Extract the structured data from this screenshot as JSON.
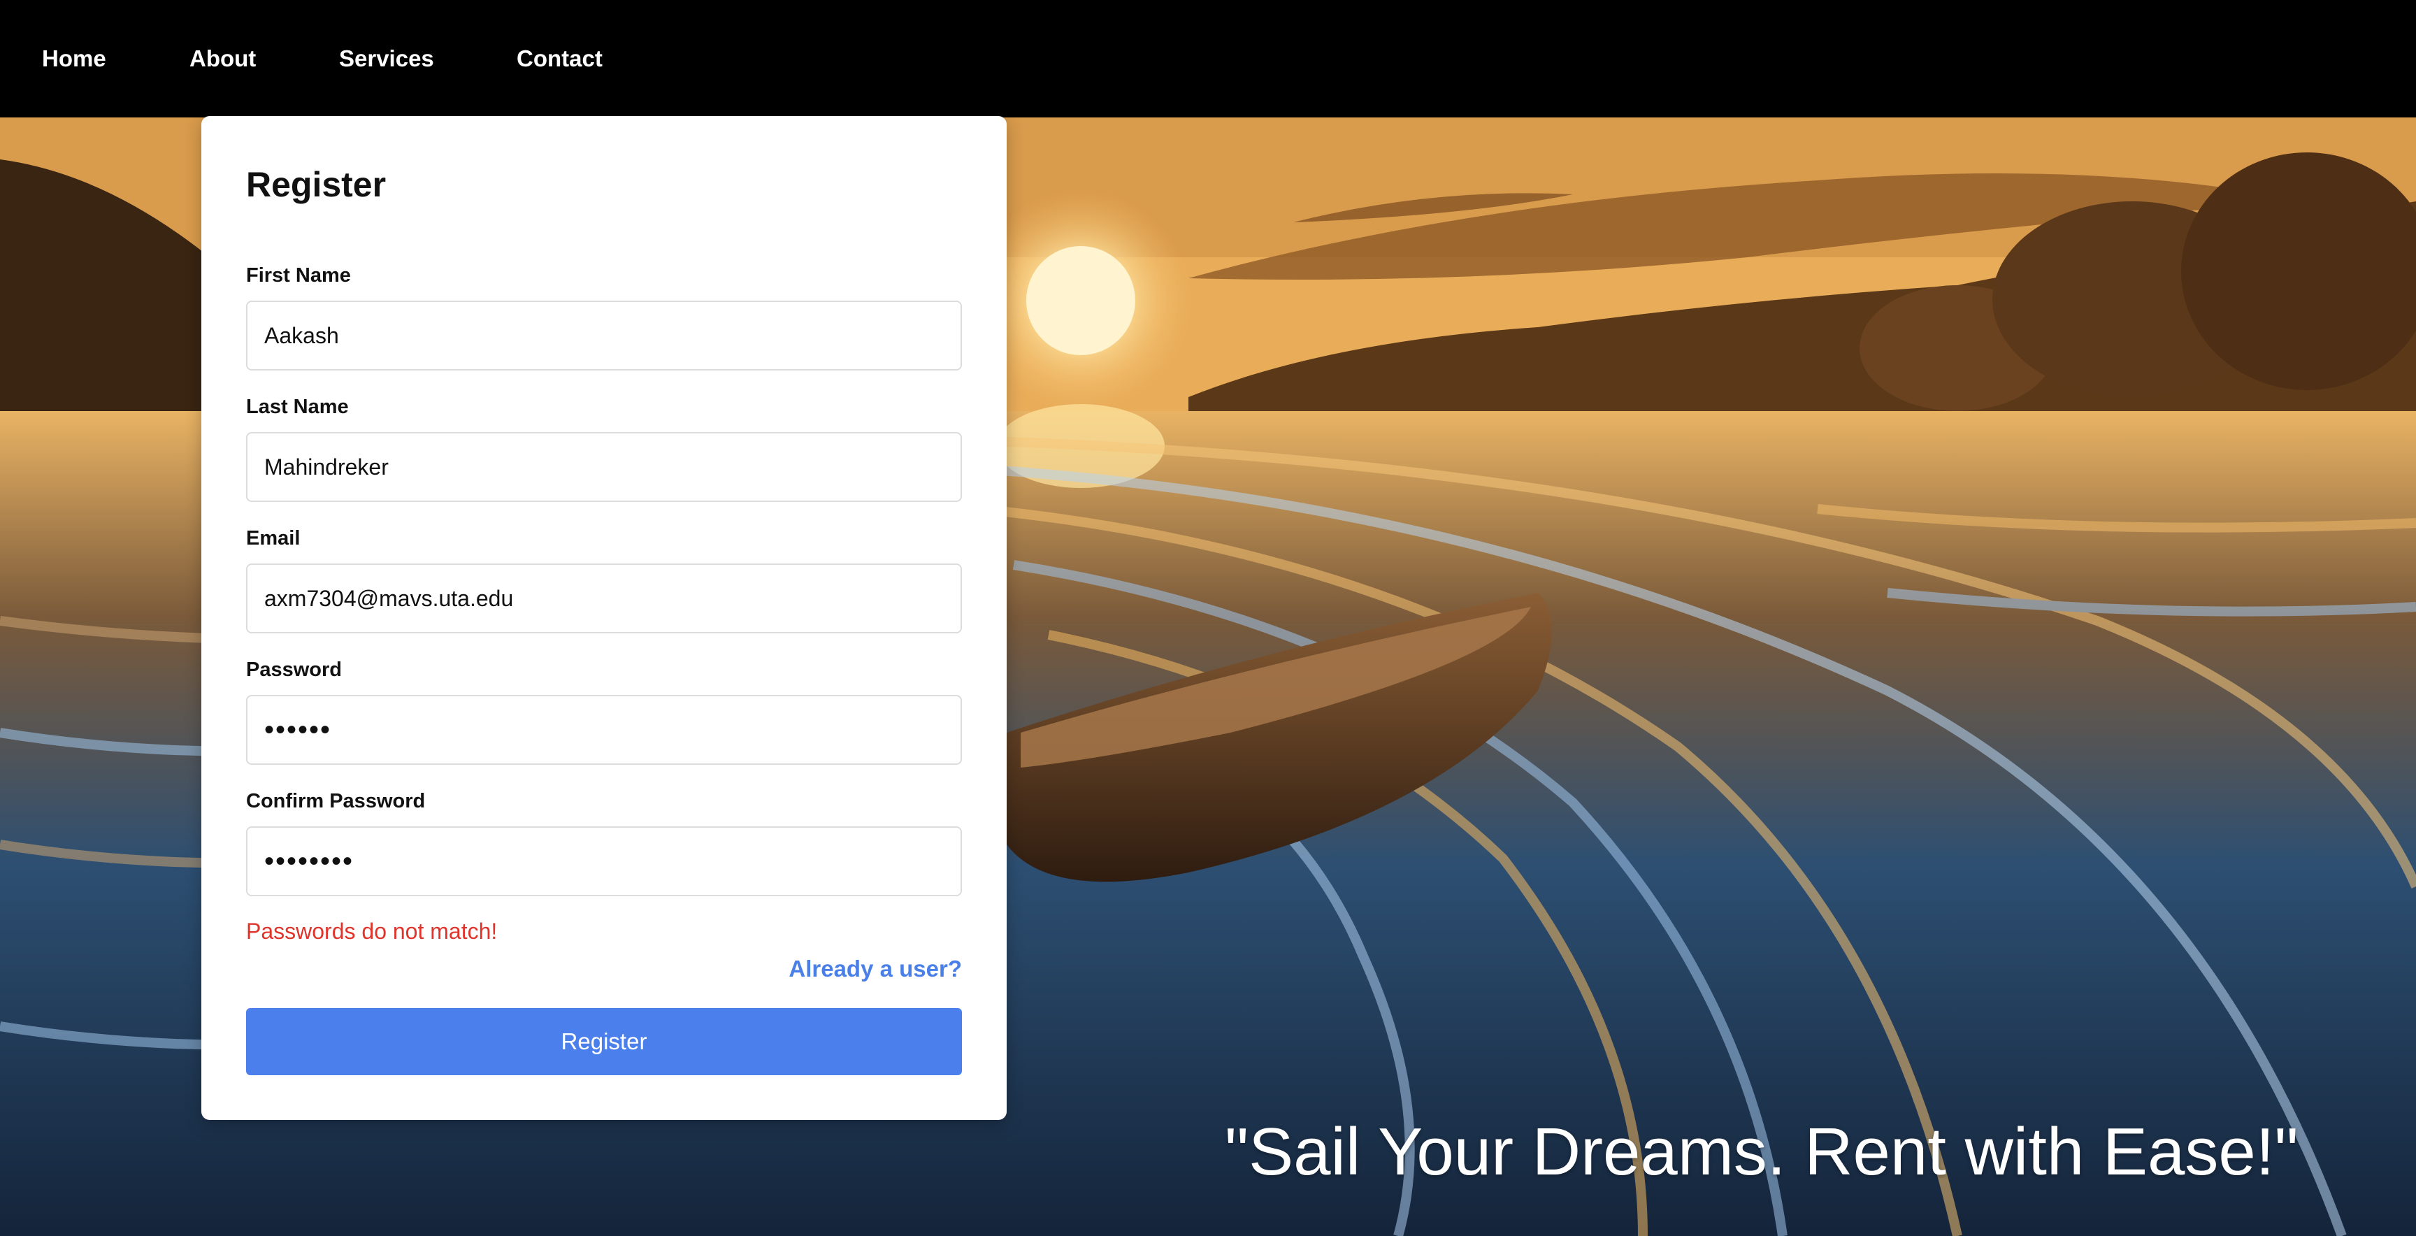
{
  "nav": {
    "items": [
      {
        "label": "Home"
      },
      {
        "label": "About"
      },
      {
        "label": "Services"
      },
      {
        "label": "Contact"
      }
    ]
  },
  "form": {
    "title": "Register",
    "fields": {
      "first_name": {
        "label": "First Name",
        "value": "Aakash"
      },
      "last_name": {
        "label": "Last Name",
        "value": "Mahindreker"
      },
      "email": {
        "label": "Email",
        "value": "axm7304@mavs.uta.edu"
      },
      "password": {
        "label": "Password",
        "value": "••••••"
      },
      "confirm_password": {
        "label": "Confirm Password",
        "value": "••••••••"
      }
    },
    "error_message": "Passwords do not match!",
    "login_link": "Already a user?",
    "submit_label": "Register"
  },
  "hero": {
    "tagline": "\"Sail Your Dreams. Rent with Ease!\"",
    "background_image": "sunset-lake-rowboat"
  },
  "colors": {
    "nav_background": "#000000",
    "primary": "#4b80ec",
    "link": "#4a7fe8",
    "error": "#e0342b",
    "card_background": "#ffffff"
  }
}
